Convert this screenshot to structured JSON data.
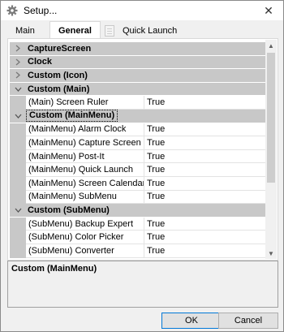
{
  "window": {
    "title": "Setup...",
    "close_glyph": "✕"
  },
  "tabs": [
    {
      "label": "Main",
      "active": false
    },
    {
      "label": "General",
      "active": true
    },
    {
      "label": "Quick Launch",
      "active": false
    }
  ],
  "grid": {
    "rows": [
      {
        "type": "category",
        "label": "CaptureScreen",
        "expanded": false
      },
      {
        "type": "category",
        "label": "Clock",
        "expanded": false
      },
      {
        "type": "category",
        "label": "Custom (Icon)",
        "expanded": false
      },
      {
        "type": "category",
        "label": "Custom (Main)",
        "expanded": true
      },
      {
        "type": "property",
        "name": "(Main) Screen Ruler",
        "value": "True"
      },
      {
        "type": "category",
        "label": "Custom (MainMenu)",
        "expanded": true,
        "selected": true
      },
      {
        "type": "property",
        "name": "(MainMenu) Alarm Clock",
        "value": "True"
      },
      {
        "type": "property",
        "name": "(MainMenu) Capture Screen",
        "value": "True"
      },
      {
        "type": "property",
        "name": "(MainMenu) Post-It",
        "value": "True"
      },
      {
        "type": "property",
        "name": "(MainMenu) Quick Launch",
        "value": "True"
      },
      {
        "type": "property",
        "name": "(MainMenu) Screen Calendar",
        "value": "True"
      },
      {
        "type": "property",
        "name": "(MainMenu) SubMenu",
        "value": "True"
      },
      {
        "type": "category",
        "label": "Custom (SubMenu)",
        "expanded": true
      },
      {
        "type": "property",
        "name": "(SubMenu) Backup Expert",
        "value": "True"
      },
      {
        "type": "property",
        "name": "(SubMenu) Color Picker",
        "value": "True"
      },
      {
        "type": "property",
        "name": "(SubMenu) Converter",
        "value": "True"
      }
    ]
  },
  "description": {
    "title": "Custom (MainMenu)"
  },
  "buttons": {
    "ok": "OK",
    "cancel": "Cancel"
  },
  "icons": {
    "title": "gear-icon",
    "tab_quick": "document-icon"
  }
}
